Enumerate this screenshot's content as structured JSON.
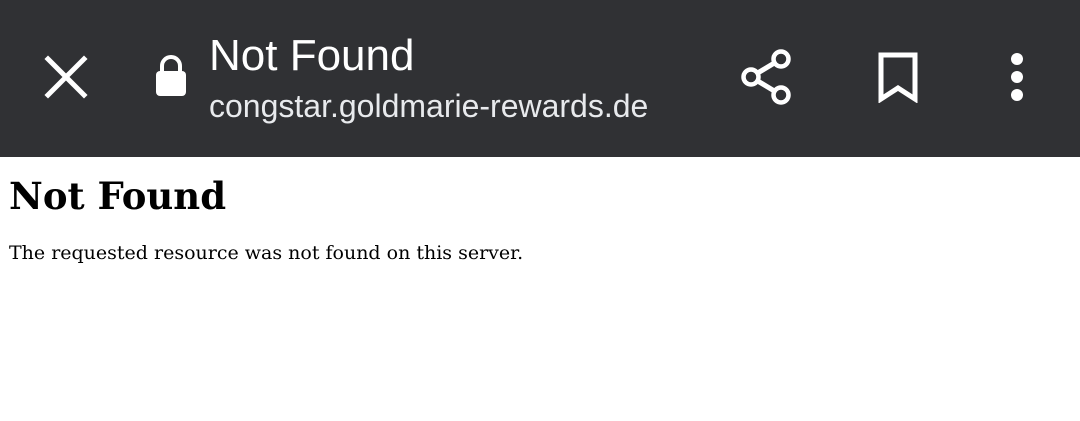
{
  "toolbar": {
    "page_title": "Not Found",
    "url": "congstar.goldmarie-rewards.de",
    "icons": {
      "close": "close-icon",
      "lock": "lock-icon",
      "share": "share-icon",
      "bookmark": "bookmark-icon",
      "menu": "more-vert-icon"
    },
    "colors": {
      "background": "#303134",
      "foreground": "#ffffff"
    }
  },
  "page": {
    "heading": "Not Found",
    "message": "The requested resource was not found on this server."
  }
}
